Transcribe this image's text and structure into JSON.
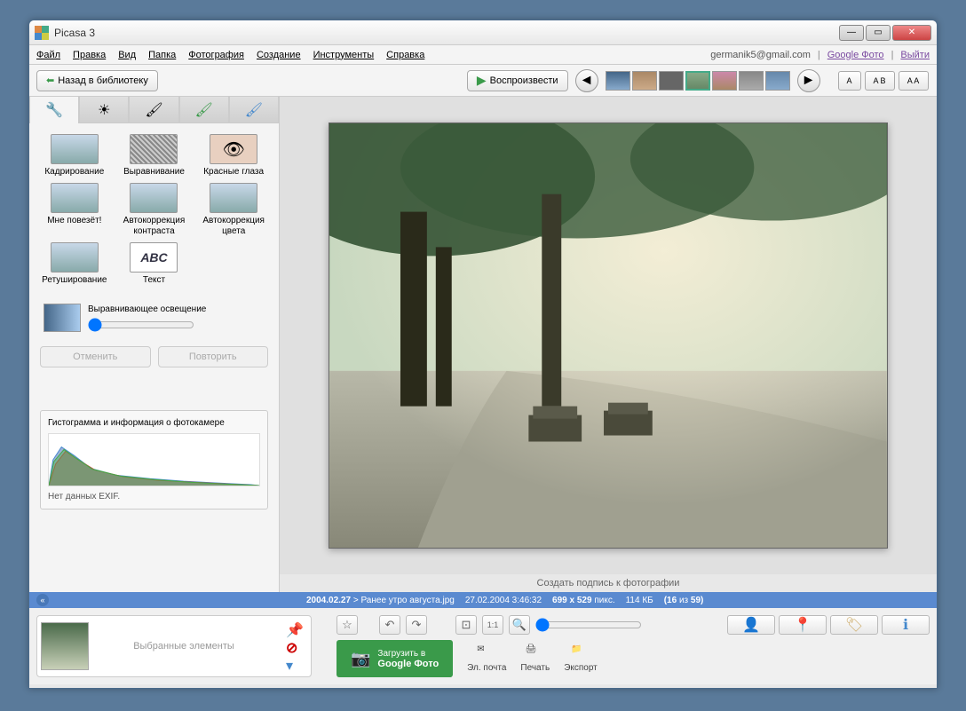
{
  "window": {
    "title": "Picasa 3"
  },
  "menu": {
    "file": "Файл",
    "edit": "Правка",
    "view": "Вид",
    "folder": "Папка",
    "photo": "Фотография",
    "create": "Создание",
    "tools": "Инструменты",
    "help": "Справка"
  },
  "account": {
    "email": "germanik5@gmail.com",
    "google_photos": "Google Фото",
    "logout": "Выйти"
  },
  "toolbar": {
    "back": "Назад в библиотеку",
    "play": "Воспроизвести",
    "share_a": "A",
    "share_ab": "A B",
    "share_aa": "A A"
  },
  "tools": {
    "crop": "Кадрирование",
    "straighten": "Выравнивание",
    "redeye": "Красные глаза",
    "lucky": "Мне повезёт!",
    "autocontrast": "Автокоррекция контраста",
    "autocolor": "Автокоррекция цвета",
    "retouch": "Ретуширование",
    "text": "Текст",
    "text_abc": "ABC",
    "fill_light": "Выравнивающее освещение",
    "undo": "Отменить",
    "redo": "Повторить"
  },
  "histogram": {
    "title": "Гистограмма и информация о фотокамере",
    "noexif": "Нет данных EXIF."
  },
  "caption": {
    "placeholder": "Создать подпись к фотографии"
  },
  "status": {
    "folder": "2004.02.27",
    "sep": ">",
    "filename": "Ранее утро августа.jpg",
    "datetime": "27.02.2004 3:46:32",
    "dims": "699 x 529",
    "dims_suffix": "пикс.",
    "size": "114 КБ",
    "counter_open": "(16",
    "counter_of": "из",
    "counter_total": "59)"
  },
  "tray": {
    "label": "Выбранные элементы"
  },
  "actions": {
    "upload_line1": "Загрузить в",
    "upload_line2": "Google Фото",
    "email": "Эл. почта",
    "print": "Печать",
    "export": "Экспорт"
  }
}
